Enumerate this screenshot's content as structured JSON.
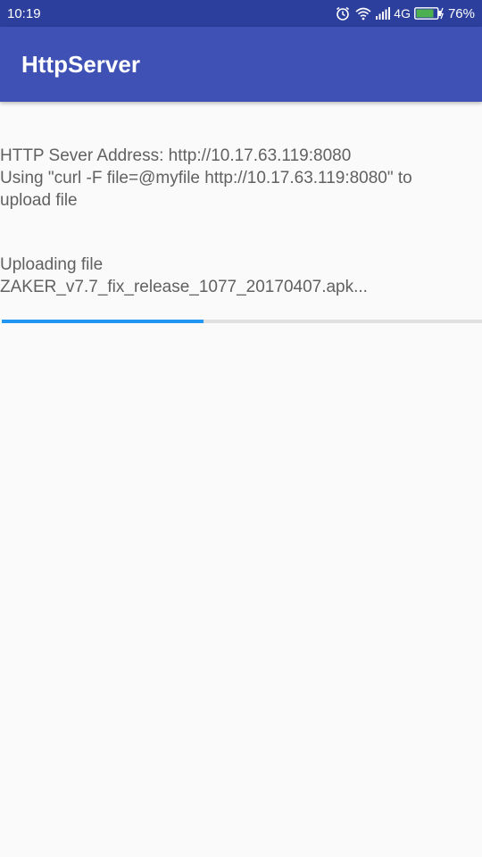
{
  "status_bar": {
    "time": "10:19",
    "network": "4G",
    "battery_percent": "76%",
    "icons": [
      "alarm-icon",
      "wifi-icon",
      "signal-icon",
      "battery-charging-icon"
    ]
  },
  "app_bar": {
    "title": "HttpServer",
    "color": "#3f51b5"
  },
  "server_info": {
    "line1": "HTTP Sever Address: http://10.17.63.119:8080",
    "line2": "Using \"curl -F file=@myfile http://10.17.63.119:8080\"  to",
    "line3": "upload file"
  },
  "upload": {
    "line1": "Uploading file",
    "line2": "ZAKER_v7.7_fix_release_1077_20170407.apk...",
    "progress_fraction": 0.42,
    "progress_color": "#2196f3"
  }
}
